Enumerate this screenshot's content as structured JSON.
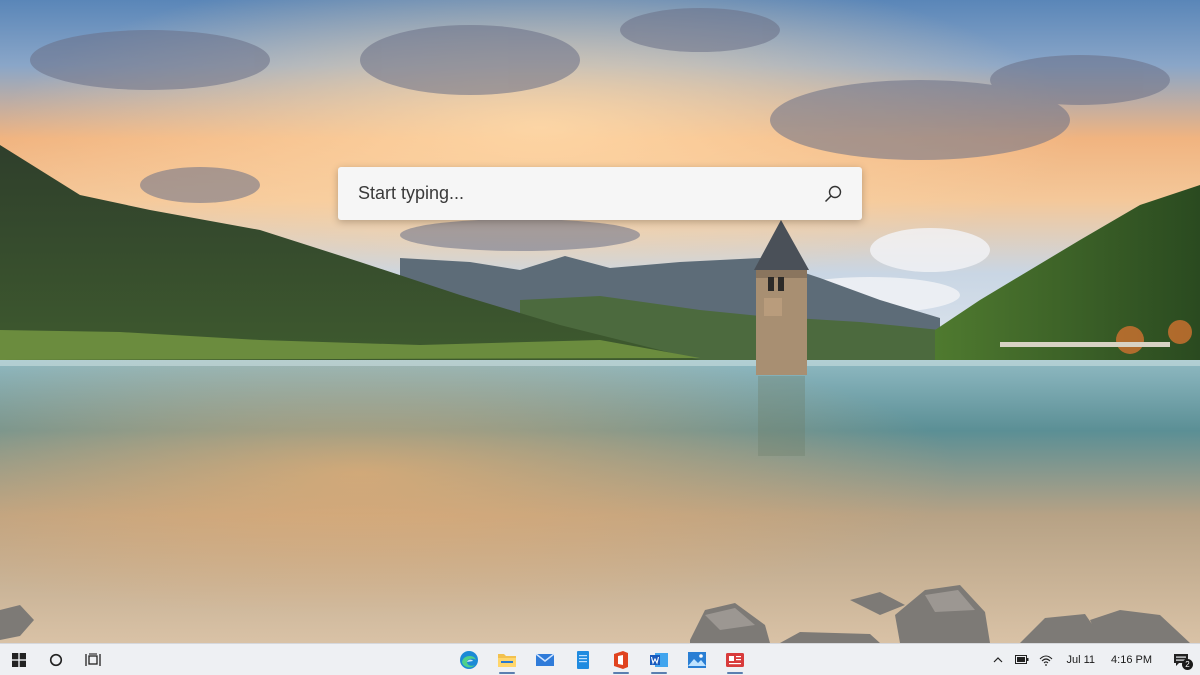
{
  "search": {
    "placeholder": "Start typing...",
    "icon": "search-icon"
  },
  "taskbar": {
    "left_buttons": [
      {
        "name": "start-button",
        "icon": "windows-logo-icon"
      },
      {
        "name": "search-button",
        "icon": "circle-icon"
      },
      {
        "name": "task-view-button",
        "icon": "task-view-icon"
      }
    ],
    "apps": [
      {
        "name": "edge",
        "icon": "edge-icon",
        "running": false
      },
      {
        "name": "file-explorer",
        "icon": "folder-icon",
        "running": true
      },
      {
        "name": "mail",
        "icon": "mail-icon",
        "running": false
      },
      {
        "name": "notepad",
        "icon": "notepad-icon",
        "running": false
      },
      {
        "name": "office",
        "icon": "office-icon",
        "running": true
      },
      {
        "name": "word",
        "icon": "word-icon",
        "running": true
      },
      {
        "name": "photos",
        "icon": "photos-icon",
        "running": false
      },
      {
        "name": "news",
        "icon": "news-icon",
        "running": true
      }
    ],
    "tray": {
      "icons": [
        "chevron-up-icon",
        "battery-icon",
        "wifi-icon"
      ],
      "date": "Jul 11",
      "time": "4:16 PM",
      "notification_count": "2"
    }
  },
  "colors": {
    "taskbar_bg": "#eef0f3",
    "accent": "#5a7fb0"
  }
}
